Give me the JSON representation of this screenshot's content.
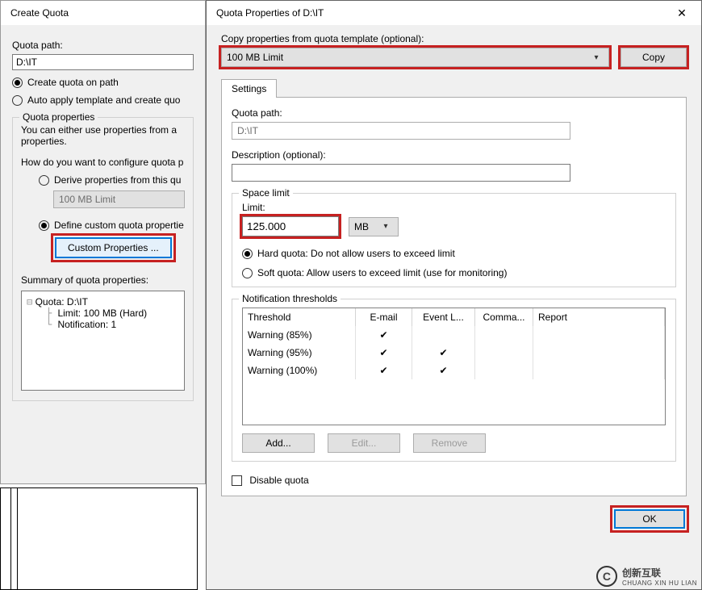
{
  "createQuota": {
    "title": "Create Quota",
    "pathLabel": "Quota path:",
    "pathValue": "D:\\IT",
    "radioCreate": "Create quota on path",
    "radioAuto": "Auto apply template and create quo",
    "group": {
      "title": "Quota properties",
      "intro": "You can either use properties from a",
      "intro2": "properties.",
      "configQ": "How do you want to configure quota p",
      "radioDerive": "Derive properties from this qu",
      "templateCombo": "100 MB Limit",
      "radioDefine": "Define custom quota propertie",
      "customBtn": "Custom Properties ...",
      "summaryLabel": "Summary of quota properties:",
      "tree": {
        "root": "Quota: D:\\IT",
        "limit": "Limit: 100 MB (Hard)",
        "notif": "Notification: 1"
      }
    }
  },
  "props": {
    "title": "Quota Properties of D:\\IT",
    "copyLabel": "Copy properties from quota template (optional):",
    "templateCombo": "100 MB Limit",
    "copyBtn": "Copy",
    "tab": "Settings",
    "pathLabel": "Quota path:",
    "pathValue": "D:\\IT",
    "descLabel": "Description (optional):",
    "descValue": "",
    "space": {
      "title": "Space limit",
      "limitLabel": "Limit:",
      "limitValue": "125.000",
      "unit": "MB",
      "radioHard": "Hard quota: Do not allow users to exceed limit",
      "radioSoft": "Soft quota: Allow users to exceed limit (use for monitoring)"
    },
    "notif": {
      "title": "Notification thresholds",
      "headers": {
        "th": "Threshold",
        "em": "E-mail",
        "el": "Event L...",
        "cm": "Comma...",
        "rp": "Report"
      },
      "rows": [
        {
          "th": "Warning (85%)",
          "em": true,
          "el": false,
          "cm": false,
          "rp": false
        },
        {
          "th": "Warning (95%)",
          "em": true,
          "el": true,
          "cm": false,
          "rp": false
        },
        {
          "th": "Warning (100%)",
          "em": true,
          "el": true,
          "cm": false,
          "rp": false
        }
      ],
      "addBtn": "Add...",
      "editBtn": "Edit...",
      "removeBtn": "Remove"
    },
    "disableChk": "Disable quota",
    "okBtn": "OK"
  },
  "logo": {
    "main": "创新互联",
    "sub": "CHUANG XIN HU LIAN"
  },
  "glyph": {
    "tick": "✔",
    "chevronDown": "▾",
    "close": "✕",
    "boxMinus": "⊟"
  }
}
